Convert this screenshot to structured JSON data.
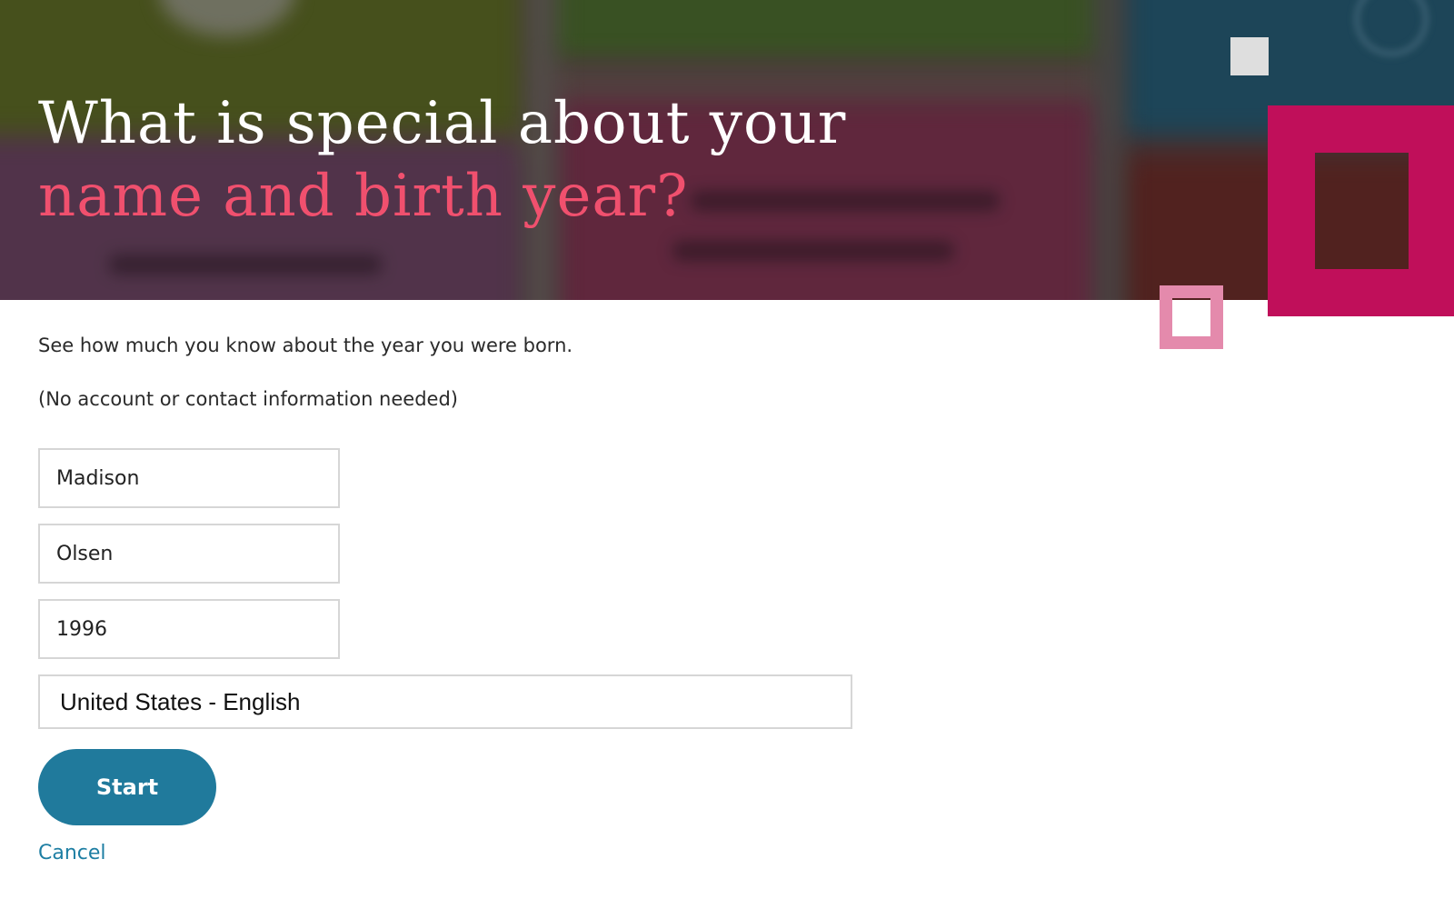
{
  "hero": {
    "title_line1": "What is special about your",
    "title_line2": "name and birth year?"
  },
  "intro": {
    "text": "See how much you know about the year you were born.",
    "note": "(No account or contact information needed)"
  },
  "form": {
    "first_name": "Madison",
    "last_name": "Olsen",
    "birth_year": "1996",
    "locale": "United States - English",
    "start_label": "Start",
    "cancel_label": "Cancel"
  },
  "colors": {
    "accent_pink": "#f0506e",
    "decor_magenta": "#c00f5a",
    "decor_light_pink": "#e48aac",
    "button_teal": "#207a9c",
    "link_teal": "#1d7ea3"
  }
}
